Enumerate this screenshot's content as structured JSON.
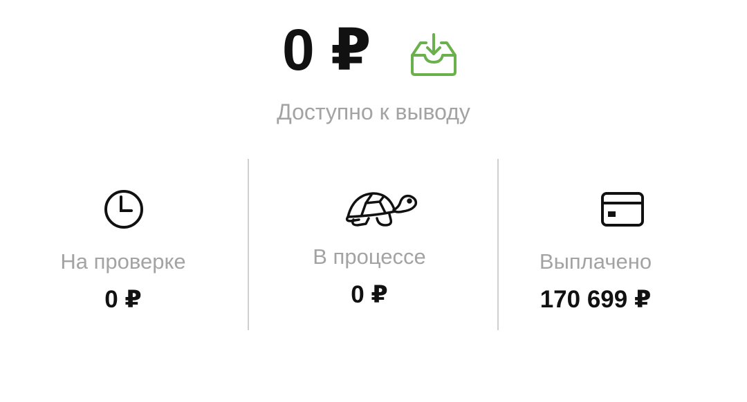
{
  "balance": {
    "amount": "0 ₽",
    "caption": "Доступно к выводу",
    "withdraw_icon": "inbox-download-icon",
    "accent_color": "#6ab04c"
  },
  "stats": [
    {
      "icon": "clock-icon",
      "label": "На проверке",
      "value": "0 ₽"
    },
    {
      "icon": "turtle-icon",
      "label": "В процессе",
      "value": "0 ₽"
    },
    {
      "icon": "credit-card-icon",
      "label": "Выплачено",
      "value": "170 699 ₽"
    }
  ]
}
